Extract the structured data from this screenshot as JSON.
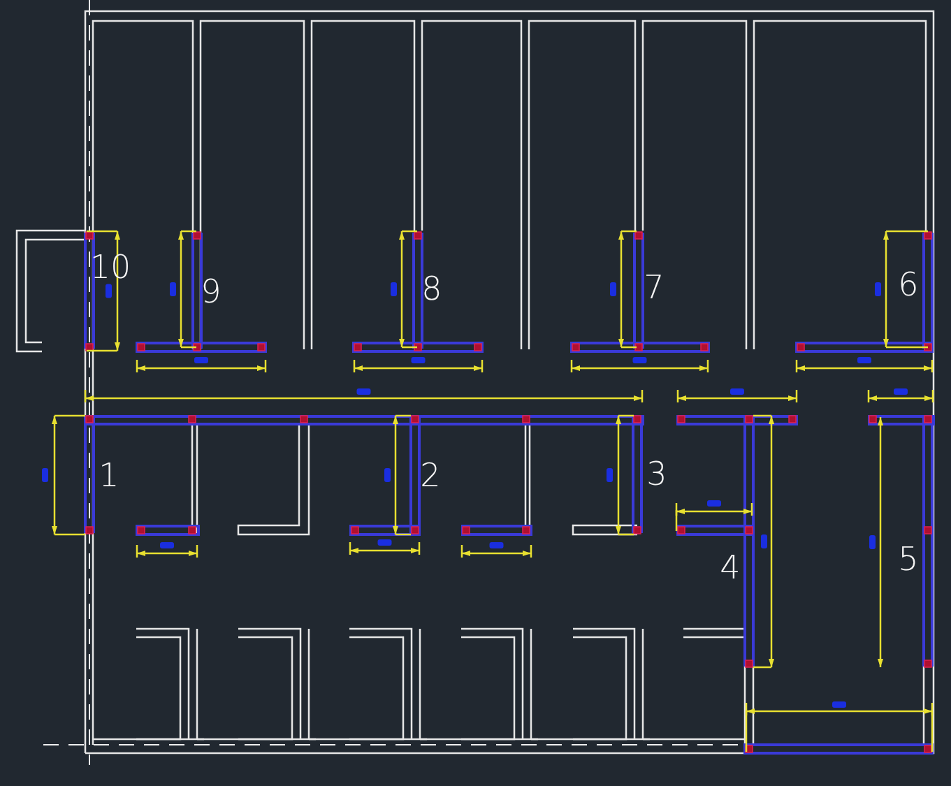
{
  "viewport": {
    "labels": [
      {
        "text": "10"
      },
      {
        "text": "9"
      },
      {
        "text": "8"
      },
      {
        "text": "7"
      },
      {
        "text": "6"
      },
      {
        "text": "1"
      },
      {
        "text": "2"
      },
      {
        "text": "3"
      },
      {
        "text": "4"
      },
      {
        "text": "5"
      }
    ]
  }
}
